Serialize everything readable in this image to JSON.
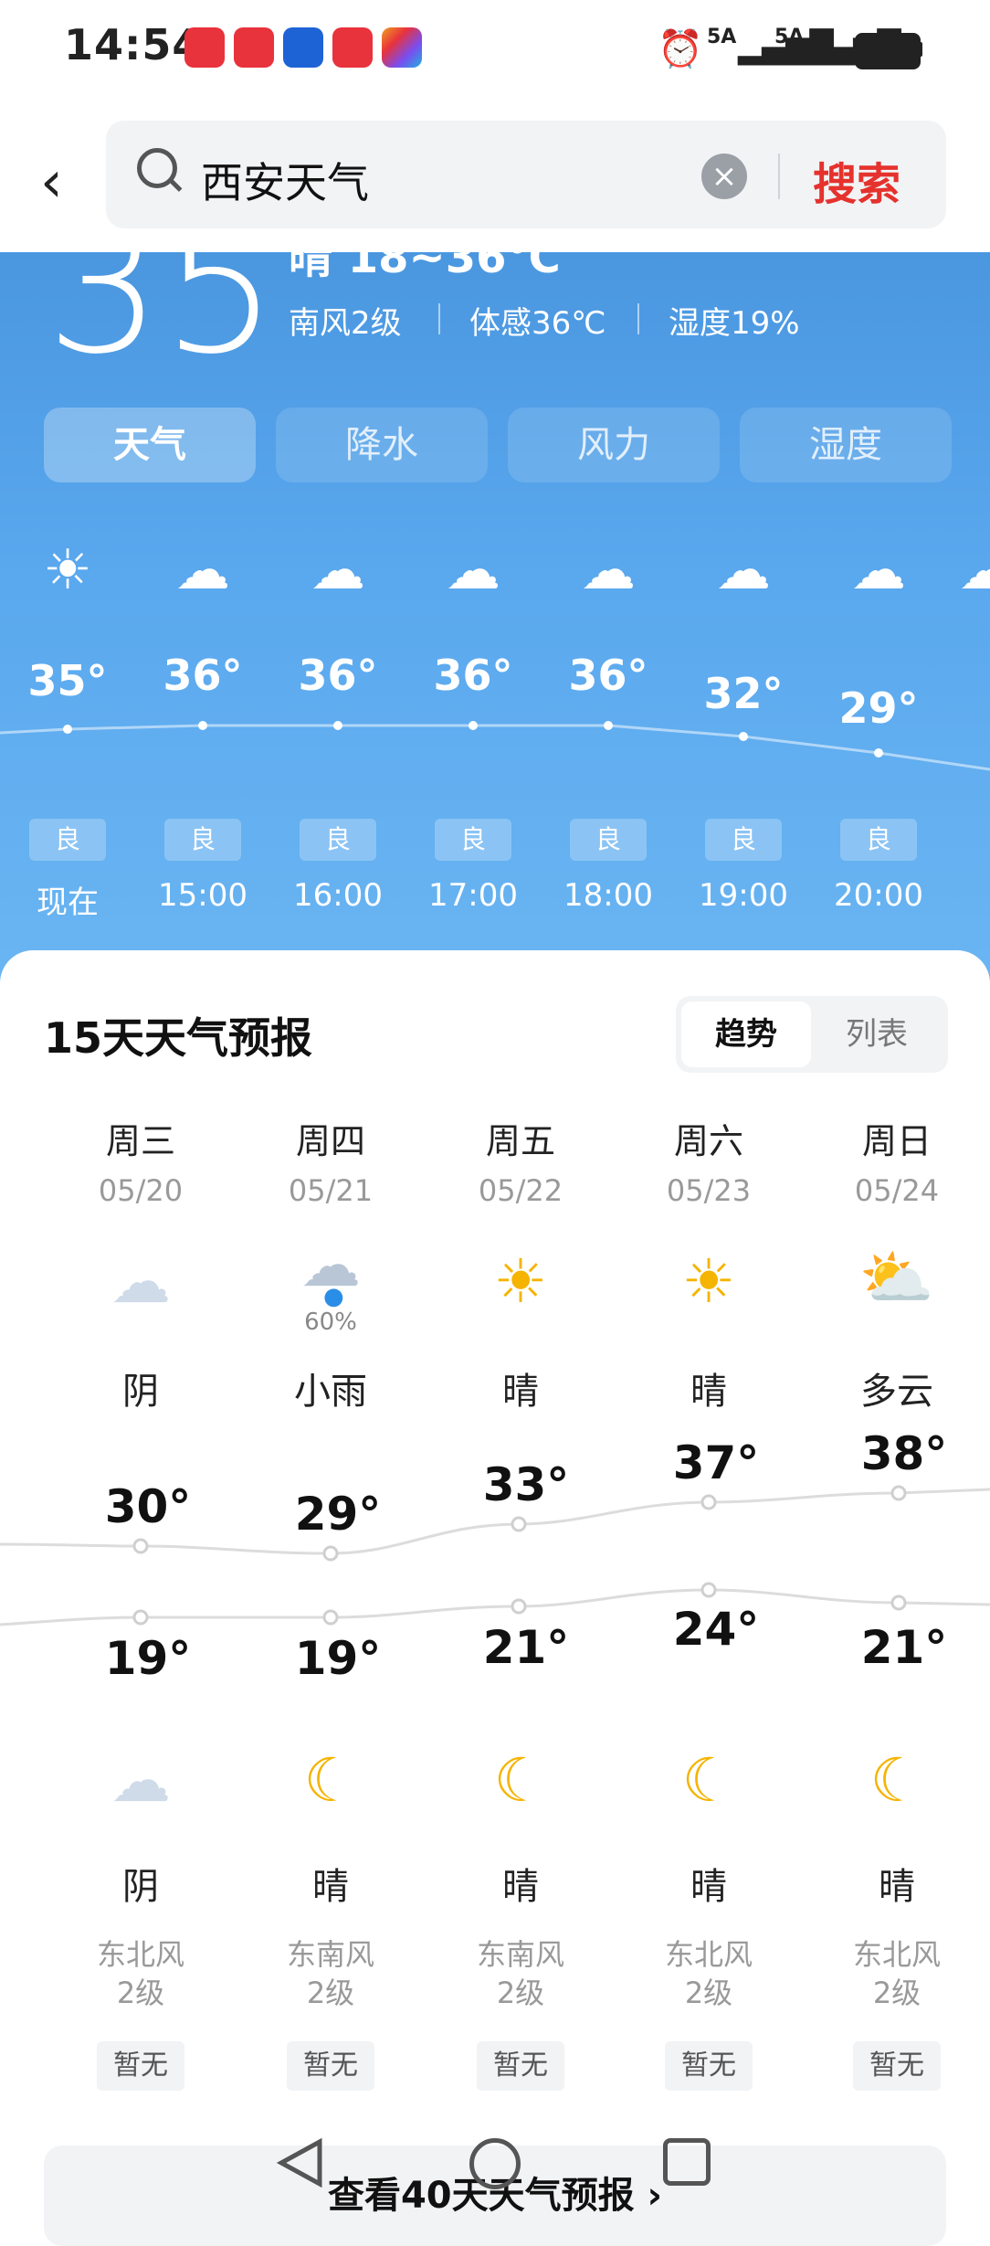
{
  "status_bar": {
    "time": "14:54",
    "apps": [
      {
        "name": "app-gallery-icon",
        "color": "#e8323c"
      },
      {
        "name": "reader-icon",
        "color": "#e8323c"
      },
      {
        "name": "lightbulb-app-icon",
        "color": "#1e63d6"
      },
      {
        "name": "toutiao-icon",
        "color": "#e8323c"
      },
      {
        "name": "photos-icon",
        "color": "#f0a020"
      }
    ],
    "signal1": "5A",
    "signal2": "5A"
  },
  "header": {
    "query": "西安天气",
    "search_label": "搜索"
  },
  "current": {
    "temp": "35",
    "condition": "晴 18~36°C",
    "wind": "南风2级",
    "feels_like": "体感36℃",
    "humidity": "湿度19%"
  },
  "tabs": [
    {
      "label": "天气",
      "active": true
    },
    {
      "label": "降水",
      "active": false
    },
    {
      "label": "风力",
      "active": false
    },
    {
      "label": "湿度",
      "active": false
    }
  ],
  "hourly": [
    {
      "time": "现在",
      "temp": "35°",
      "aqi": "良",
      "icon": "sun-icon"
    },
    {
      "time": "15:00",
      "temp": "36°",
      "aqi": "良",
      "icon": "cloud-icon"
    },
    {
      "time": "16:00",
      "temp": "36°",
      "aqi": "良",
      "icon": "cloud-icon"
    },
    {
      "time": "17:00",
      "temp": "36°",
      "aqi": "良",
      "icon": "cloud-icon"
    },
    {
      "time": "18:00",
      "temp": "36°",
      "aqi": "良",
      "icon": "cloud-icon"
    },
    {
      "time": "19:00",
      "temp": "32°",
      "aqi": "良",
      "icon": "cloud-icon"
    },
    {
      "time": "20:00",
      "temp": "29°",
      "aqi": "良",
      "icon": "moon-cloud-icon"
    }
  ],
  "forecast": {
    "title": "15天天气预报",
    "seg_trend": "趋势",
    "seg_list": "列表",
    "days": [
      {
        "name": "周三",
        "date": "05/20",
        "day_icon": "overcast-icon",
        "precip": "",
        "day_cond": "阴",
        "high": "30°",
        "low": "19°",
        "night_icon": "overcast-icon",
        "night_cond": "阴",
        "wind": "东北风",
        "level": "2级",
        "aqi": "暂无"
      },
      {
        "name": "周四",
        "date": "05/21",
        "day_icon": "rain-icon",
        "precip": "60%",
        "day_cond": "小雨",
        "high": "29°",
        "low": "19°",
        "night_icon": "moon-icon",
        "night_cond": "晴",
        "wind": "东南风",
        "level": "2级",
        "aqi": "暂无"
      },
      {
        "name": "周五",
        "date": "05/22",
        "day_icon": "sun-icon",
        "precip": "",
        "day_cond": "晴",
        "high": "33°",
        "low": "21°",
        "night_icon": "moon-icon",
        "night_cond": "晴",
        "wind": "东南风",
        "level": "2级",
        "aqi": "暂无"
      },
      {
        "name": "周六",
        "date": "05/23",
        "day_icon": "sun-icon",
        "precip": "",
        "day_cond": "晴",
        "high": "37°",
        "low": "24°",
        "night_icon": "moon-icon",
        "night_cond": "晴",
        "wind": "东北风",
        "level": "2级",
        "aqi": "暂无"
      },
      {
        "name": "周日",
        "date": "05/24",
        "day_icon": "partly-cloudy-icon",
        "precip": "",
        "day_cond": "多云",
        "high": "38°",
        "low": "21°",
        "night_icon": "moon-icon",
        "night_cond": "晴",
        "wind": "东北风",
        "level": "2级",
        "aqi": "暂无"
      }
    ],
    "more_label": "查看40天天气预报 ›"
  }
}
